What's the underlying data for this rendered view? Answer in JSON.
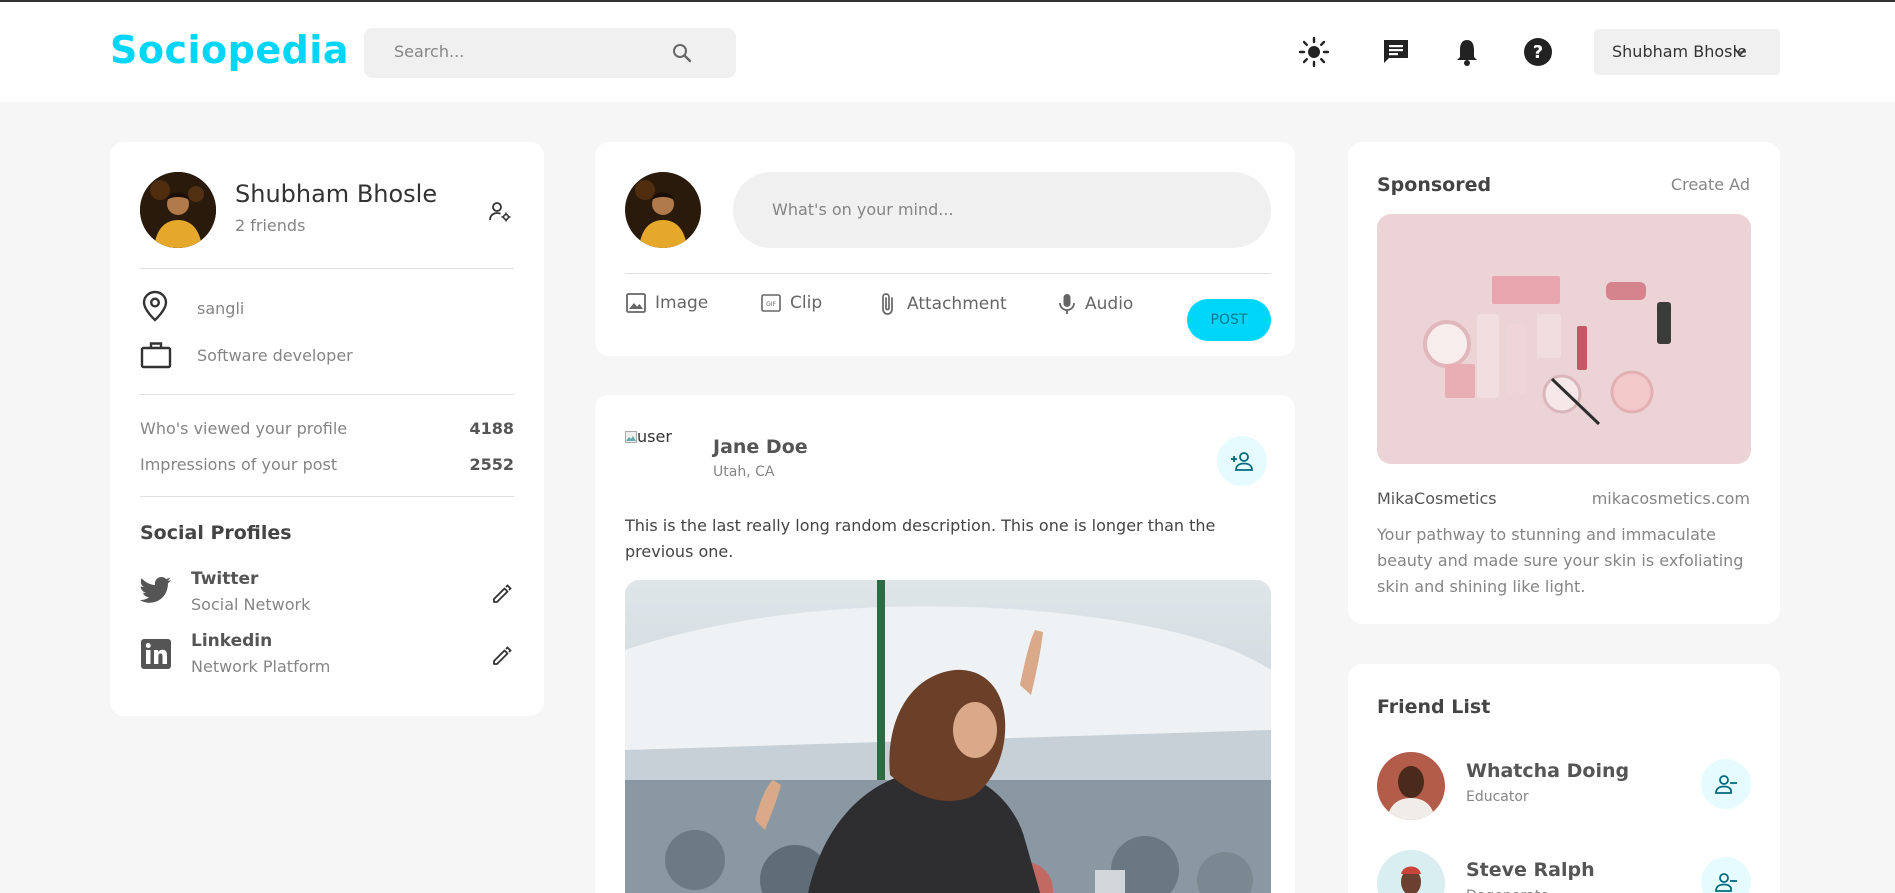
{
  "navbar": {
    "logo": "Sociopedia",
    "search_placeholder": "Search...",
    "user_name": "Shubham Bhosle",
    "icons": [
      "sun-icon",
      "message-icon",
      "bell-icon",
      "help-icon"
    ]
  },
  "profile": {
    "name": "Shubham Bhosle",
    "friends": "2 friends",
    "location": "sangli",
    "occupation": "Software developer",
    "stats": [
      {
        "label": "Who's viewed your profile",
        "value": "4188"
      },
      {
        "label": "Impressions of your post",
        "value": "2552"
      }
    ],
    "social_heading": "Social Profiles",
    "socials": [
      {
        "name": "Twitter",
        "type": "Social Network"
      },
      {
        "name": "Linkedin",
        "type": "Network Platform"
      }
    ]
  },
  "composer": {
    "placeholder": "What's on your mind...",
    "tools": [
      "Image",
      "Clip",
      "Attachment",
      "Audio"
    ],
    "post_label": "POST"
  },
  "post": {
    "alt": "user",
    "name": "Jane Doe",
    "location": "Utah, CA",
    "description": "This is the last really long random description. This one is longer than the previous one."
  },
  "sponsored": {
    "heading": "Sponsored",
    "create_ad": "Create Ad",
    "brand": "MikaCosmetics",
    "url": "mikacosmetics.com",
    "description": "Your pathway to stunning and immaculate beauty and made sure your skin is exfoliating skin and shining like light."
  },
  "friend_list": {
    "heading": "Friend List",
    "friends": [
      {
        "name": "Whatcha Doing",
        "role": "Educator"
      },
      {
        "name": "Steve Ralph",
        "role": "Degenerate"
      }
    ]
  },
  "colors": {
    "accent": "#00d5fa",
    "background": "#f6f6f6",
    "card": "#ffffff"
  }
}
